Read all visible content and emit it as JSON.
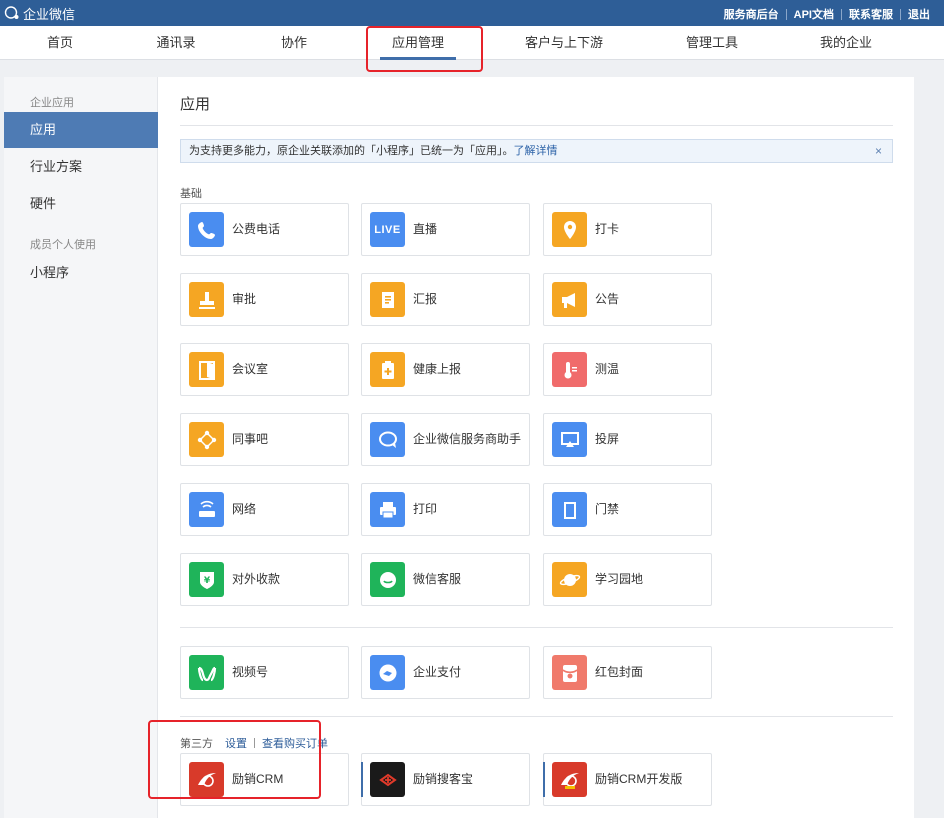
{
  "brand": "企业微信",
  "top_links": [
    "服务商后台",
    "API文档",
    "联系客服",
    "退出"
  ],
  "nav": [
    "首页",
    "通讯录",
    "协作",
    "应用管理",
    "客户与上下游",
    "管理工具",
    "我的企业"
  ],
  "sidebar": {
    "group1": "企业应用",
    "items1": [
      "应用",
      "行业方案",
      "硬件"
    ],
    "group2": "成员个人使用",
    "items2": [
      "小程序"
    ]
  },
  "content": {
    "title": "应用",
    "notice_text": "为支持更多能力，原企业关联添加的「小程序」已统一为「应用」。",
    "notice_link": "了解详情",
    "notice_close": "×",
    "basic_label": "基础",
    "basic_apps": [
      {
        "label": "公费电话",
        "icon": "phone-icon",
        "color": "#4a8df0"
      },
      {
        "label": "直播",
        "icon": "live-icon",
        "color": "#4a8df0",
        "text": "LIVE"
      },
      {
        "label": "打卡",
        "icon": "location-pin-icon",
        "color": "#f5a623"
      },
      {
        "label": "审批",
        "icon": "stamp-icon",
        "color": "#f5a623"
      },
      {
        "label": "汇报",
        "icon": "report-icon",
        "color": "#f5a623"
      },
      {
        "label": "公告",
        "icon": "megaphone-icon",
        "color": "#f5a623"
      },
      {
        "label": "会议室",
        "icon": "door-icon",
        "color": "#f5a623"
      },
      {
        "label": "健康上报",
        "icon": "health-icon",
        "color": "#f5a623"
      },
      {
        "label": "测温",
        "icon": "thermometer-icon",
        "color": "#f06b6b"
      },
      {
        "label": "同事吧",
        "icon": "network-icon",
        "color": "#f5a623"
      },
      {
        "label": "企业微信服务商助手",
        "icon": "chat-bubble-icon",
        "color": "#4a8df0"
      },
      {
        "label": "投屏",
        "icon": "screencast-icon",
        "color": "#4a8df0"
      },
      {
        "label": "网络",
        "icon": "router-icon",
        "color": "#4a8df0"
      },
      {
        "label": "打印",
        "icon": "printer-icon",
        "color": "#4a8df0"
      },
      {
        "label": "门禁",
        "icon": "gate-icon",
        "color": "#4a8df0"
      },
      {
        "label": "对外收款",
        "icon": "yuan-shield-icon",
        "color": "#1fb45a"
      },
      {
        "label": "微信客服",
        "icon": "customer-service-icon",
        "color": "#1fb45a"
      },
      {
        "label": "学习园地",
        "icon": "planet-icon",
        "color": "#f5a623"
      }
    ],
    "extra_apps": [
      {
        "label": "视频号",
        "icon": "channels-icon",
        "color": "#1fb45a"
      },
      {
        "label": "企业支付",
        "icon": "payment-icon",
        "color": "#4a8df0"
      },
      {
        "label": "红包封面",
        "icon": "red-envelope-icon",
        "color": "#f07a6b"
      }
    ],
    "third_label": "第三方",
    "third_links": [
      "设置",
      "查看购买订单"
    ],
    "third_apps": [
      {
        "label": "励销CRM",
        "icon": "lixiao-crm-icon",
        "color": "#d83a2a"
      },
      {
        "label": "励销搜客宝",
        "icon": "lixiao-soukebao-icon",
        "color": "#1a1a1a"
      },
      {
        "label": "励销CRM开发版",
        "icon": "lixiao-crm-dev-icon",
        "color": "#d83a2a"
      }
    ]
  }
}
